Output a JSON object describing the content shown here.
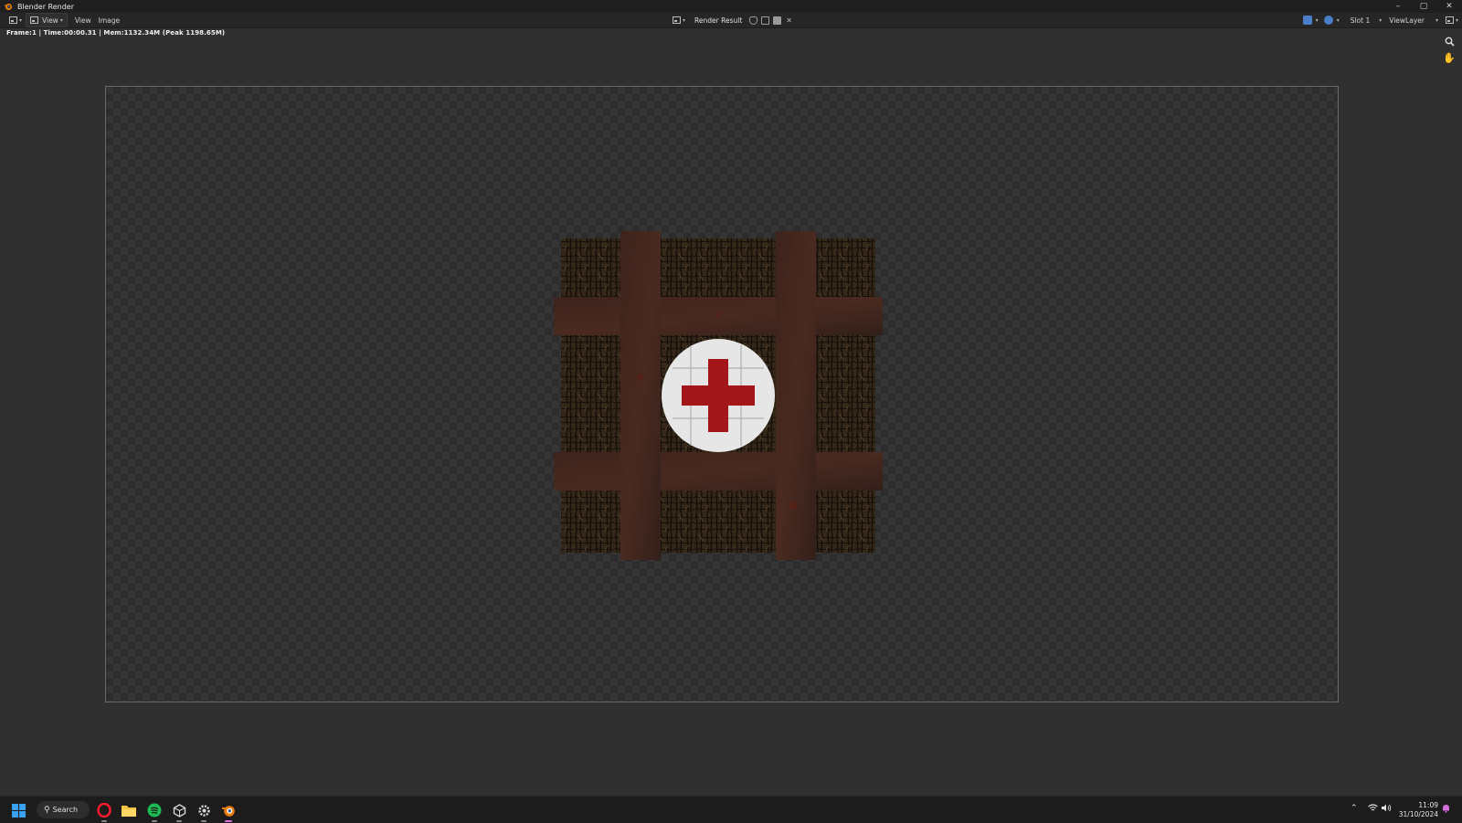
{
  "window": {
    "title": "Blender Render",
    "controls": {
      "minimize": "–",
      "maximize": "▢",
      "close": "✕"
    }
  },
  "header": {
    "menu": [
      "View",
      "View",
      "Image"
    ],
    "image_name": "Render Result",
    "slot": "Slot 1",
    "view_layer": "ViewLayer"
  },
  "frame_info": "Frame:1 | Time:00:00.31 | Mem:1132.34M (Peak 1198.65M)",
  "render": {
    "subject": "crate with red cross"
  },
  "taskbar": {
    "search_label": "Search",
    "time": "11:09",
    "date": "31/10/2024"
  },
  "colors": {
    "accent_blue": "#4a7ec9",
    "blender_orange": "#e87d0d",
    "cross_red": "#a3161a",
    "spotify_green": "#1db954"
  },
  "icons": {
    "gizmos": [
      "zoom-icon",
      "hand-icon"
    ],
    "taskbar": [
      "windows-start-icon",
      "opera-icon",
      "file-explorer-icon",
      "spotify-icon",
      "unity-icon",
      "settings-gear-icon",
      "blender-icon"
    ],
    "tray": [
      "chevron-up-icon",
      "wifi-icon",
      "volume-icon",
      "notification-bell-icon"
    ]
  }
}
